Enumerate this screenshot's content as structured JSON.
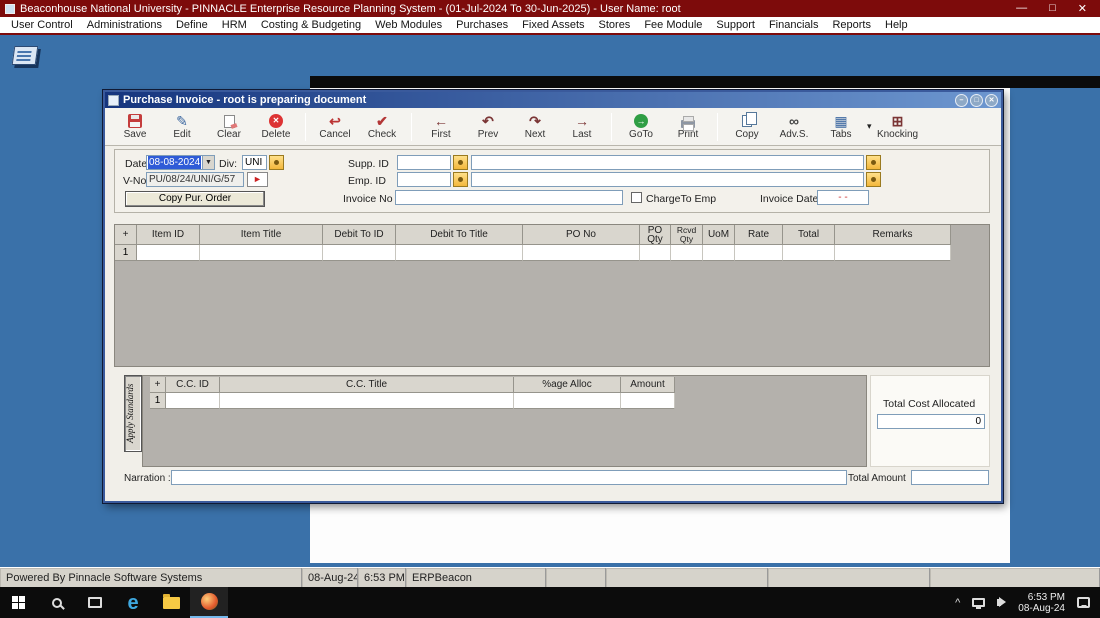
{
  "titlebar": {
    "title": "Beaconhouse National University - PINNACLE Enterprise Resource Planning System - (01-Jul-2024 To 30-Jun-2025) - User Name: root",
    "minimize": "—",
    "maximize": "□",
    "close": "✕"
  },
  "menu": {
    "items": [
      "User Control",
      "Administrations",
      "Define",
      "HRM",
      "Costing & Budgeting",
      "Web Modules",
      "Purchases",
      "Fixed Assets",
      "Stores",
      "Fee Module",
      "Support",
      "Financials",
      "Reports",
      "Help"
    ]
  },
  "dialog": {
    "title": "Purchase Invoice - root is preparing document",
    "window_buttons": {
      "minimize": "–",
      "restore": "□",
      "close": "✕"
    },
    "toolbar": [
      {
        "name": "save",
        "label": "Save",
        "glyph": ""
      },
      {
        "name": "edit",
        "label": "Edit",
        "glyph": "✎"
      },
      {
        "name": "clear",
        "label": "Clear",
        "glyph": ""
      },
      {
        "name": "delete",
        "label": "Delete",
        "glyph": "✕"
      },
      {
        "name": "cancel",
        "label": "Cancel",
        "glyph": "↩"
      },
      {
        "name": "check",
        "label": "Check",
        "glyph": "✔"
      },
      {
        "name": "first",
        "label": "First",
        "glyph": "←"
      },
      {
        "name": "prev",
        "label": "Prev",
        "glyph": "↶"
      },
      {
        "name": "next",
        "label": "Next",
        "glyph": "↷"
      },
      {
        "name": "last",
        "label": "Last",
        "glyph": "→"
      },
      {
        "name": "goto",
        "label": "GoTo",
        "glyph": "→"
      },
      {
        "name": "print",
        "label": "Print",
        "glyph": ""
      },
      {
        "name": "copy",
        "label": "Copy",
        "glyph": ""
      },
      {
        "name": "advs",
        "label": "Adv.S.",
        "glyph": "∞"
      },
      {
        "name": "tabs",
        "label": "Tabs",
        "glyph": "▦"
      },
      {
        "name": "knocking",
        "label": "Knocking",
        "glyph": "⊞"
      }
    ],
    "toolbar_more_glyph": "▾",
    "form": {
      "date_label": "Date",
      "date_value": "08-08-2024",
      "combo_arrow_glyph": "▼",
      "div_label": "Div:",
      "div_value": "UNI",
      "vno_label": "V-No.",
      "vno_value": "PU/08/24/UNI/G/57",
      "vno_arrow_glyph": "►",
      "copy_po_button": "Copy Pur. Order",
      "supp_label": "Supp. ID",
      "emp_label": "Emp. ID",
      "invoice_no_label": "Invoice No",
      "charge_emp_label": "ChargeTo Emp",
      "invoice_date_label": "Invoice Date",
      "invoice_date_value": "- -"
    },
    "items_grid": {
      "columns": [
        "+",
        "Item  ID",
        "Item  Title",
        "Debit To ID",
        "Debit To  Title",
        "PO  No",
        "PO Qty",
        "Rcvd Qty",
        "UoM",
        "Rate",
        "Total",
        "Remarks"
      ],
      "row_number": "1"
    },
    "cc_grid": {
      "columns": [
        "+",
        "C.C. ID",
        "C.C. Title",
        "%age Alloc",
        "Amount"
      ],
      "row_number": "1",
      "apply_standards_label": "Apply Standards",
      "total_cost_label": "Total Cost Allocated",
      "total_cost_value": "0"
    },
    "footer": {
      "narration_label": "Narration :",
      "total_amount_label": "Total Amount"
    }
  },
  "statusbar": {
    "powered": "Powered By Pinnacle Software Systems",
    "date": "08-Aug-24",
    "time": "6:53 PM",
    "app": "ERPBeacon"
  },
  "taskbar": {
    "tray_chevron": "^",
    "clock_time": "6:53 PM",
    "clock_date": "08-Aug-24"
  }
}
